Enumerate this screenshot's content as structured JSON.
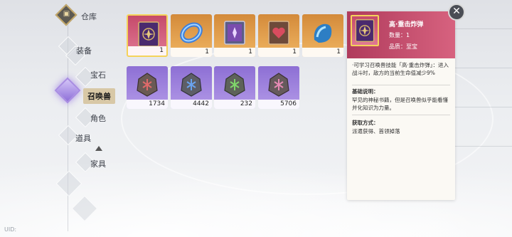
{
  "nav": {
    "home_label": "仓库",
    "items": [
      {
        "label": "装备"
      },
      {
        "label": "宝石"
      },
      {
        "label": "召唤兽",
        "active": true
      },
      {
        "label": "角色"
      },
      {
        "label": "道具"
      },
      {
        "label": "家具"
      }
    ]
  },
  "items": [
    {
      "count": "1",
      "rarity": "red",
      "icon": "summon-book-icon"
    },
    {
      "count": "1",
      "rarity": "gold",
      "icon": "blue-ring-icon"
    },
    {
      "count": "1",
      "rarity": "gold",
      "icon": "purple-book-icon"
    },
    {
      "count": "1",
      "rarity": "gold",
      "icon": "heart-book-icon"
    },
    {
      "count": "1",
      "rarity": "gold",
      "icon": "blue-scroll-icon"
    },
    {
      "count": "1734",
      "rarity": "purple",
      "icon": "red-stone-icon"
    },
    {
      "count": "4442",
      "rarity": "purple",
      "icon": "blue-stone-icon"
    },
    {
      "count": "232",
      "rarity": "purple",
      "icon": "green-stone-icon"
    },
    {
      "count": "5706",
      "rarity": "purple",
      "icon": "pink-stone-icon"
    }
  ],
  "detail": {
    "title": "高·重击炸弹",
    "count": "数量：1",
    "quality": "品质：至宝",
    "effect": "·可学习召唤兽技能「高·重击炸弹」：进入战斗时，敌方的当前生命值减少9%",
    "basic_header": "基础说明：",
    "basic_text": "罕见的神秘书籍，但是召唤兽似乎能看懂并化知识为力量。",
    "source_header": "获取方式：",
    "source_text": "派遣获得、首领掉落"
  },
  "close_icon": "close-icon",
  "uid_label": "UID:"
}
